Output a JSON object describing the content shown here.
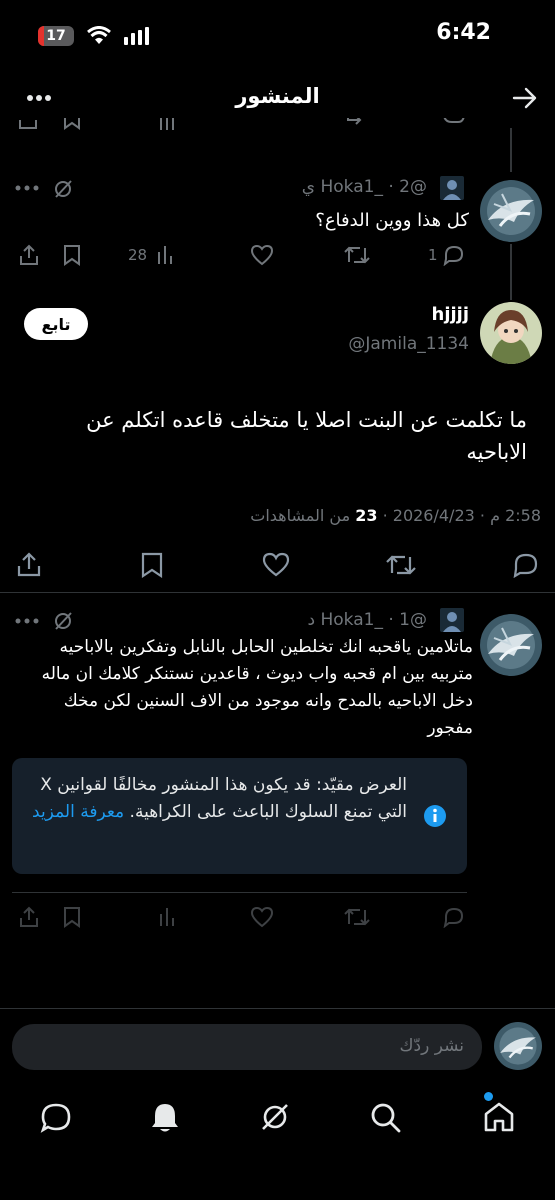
{
  "status_bar": {
    "time": "6:42",
    "battery": "17"
  },
  "header": {
    "title": "المنشور"
  },
  "prev_reply": {
    "handle_line": "@Hoka1_ · 2 ي",
    "text": "كل هذا ووين الدفاع؟",
    "reply_count": "1",
    "views": "28"
  },
  "main_post": {
    "name": "hjjjj",
    "handle": "@Jamila_1134",
    "follow_label": "تابع",
    "text": "ما تكلمت عن البنت اصلا يا متخلف قاعده اتكلم عن الاباحيه",
    "meta": {
      "date_time": "2:58 م · 2026/4/23 · ",
      "views_count": "23",
      "views_label": " من المشاهدات"
    }
  },
  "reply": {
    "handle_line": "@Hoka1_ · 1 د",
    "text": "ماتلامين ياقحبه انك تخلطين الحابل بالنابل وتفكرين بالاباحيه متربيه بين ام قحبه واب ديوث ، قاعدين نستنكر كلامك ان ماله دخل الاباحيه بالمدح وانه موجود من الاف السنين لكن مخك مفجور",
    "notice": {
      "text": "العرض مقيّد: قد يكون هذا المنشور مخالفًا لقوانين X التي تمنع السلوك الباعث على الكراهية.",
      "link": "معرفة المزيد"
    }
  },
  "composer": {
    "placeholder": "نشر ردّك"
  },
  "colors": {
    "accent": "#1d9bf0",
    "background": "#000000",
    "notice_bg": "#16202b"
  },
  "icons": [
    "back-arrow-icon",
    "more-icon",
    "reply-icon",
    "repost-icon",
    "like-icon",
    "views-icon",
    "bookmark-icon",
    "share-icon",
    "grok-icon",
    "info-icon",
    "home-icon",
    "search-icon",
    "bell-icon",
    "messages-icon"
  ]
}
